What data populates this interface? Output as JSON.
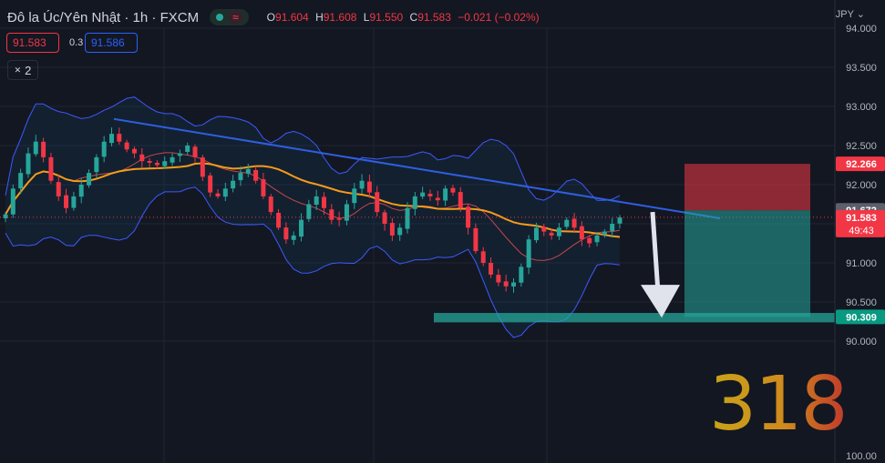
{
  "header": {
    "symbol": "Đô la Úc/Yên Nhật · 1h · FXCM",
    "ohlc": {
      "o_label": "O",
      "o": "91.604",
      "h_label": "H",
      "h": "91.608",
      "l_label": "L",
      "l": "91.550",
      "c_label": "C",
      "c": "91.583",
      "change": "−0.021 (−0.02%)"
    }
  },
  "quote": {
    "sell": "91.583",
    "spread": "0.3",
    "buy": "91.586"
  },
  "indicators_toggle": {
    "label": "2"
  },
  "currency": "JPY ⌄",
  "watermark": "318",
  "colors": {
    "up": "#26a69a",
    "down": "#f23645",
    "trendline": "#2f5fe0",
    "ma": "#f59c1a",
    "band": "#3d5afe"
  },
  "chart_data": {
    "type": "candlestick",
    "symbol": "AUDJPY",
    "timeframe": "1h",
    "y_axis": {
      "ticks": [
        "94.000",
        "93.500",
        "93.000",
        "92.500",
        "92.000",
        "91.500",
        "91.000",
        "90.500",
        "90.000",
        "100.00"
      ],
      "ylim": [
        89.6,
        94.1
      ],
      "side": "right"
    },
    "close_series": [
      91.62,
      91.95,
      92.15,
      92.4,
      92.55,
      92.35,
      92.05,
      91.85,
      91.7,
      91.85,
      92.0,
      92.15,
      92.35,
      92.55,
      92.65,
      92.55,
      92.45,
      92.4,
      92.3,
      92.28,
      92.25,
      92.3,
      92.35,
      92.4,
      92.5,
      92.35,
      92.1,
      91.9,
      91.85,
      91.95,
      92.05,
      92.15,
      92.2,
      92.05,
      91.85,
      91.65,
      91.45,
      91.3,
      91.35,
      91.55,
      91.75,
      91.85,
      91.7,
      91.55,
      91.55,
      91.75,
      91.95,
      92.05,
      91.9,
      91.65,
      91.5,
      91.35,
      91.45,
      91.7,
      91.85,
      91.9,
      91.85,
      91.8,
      91.95,
      91.9,
      91.7,
      91.45,
      91.15,
      91.0,
      90.85,
      90.75,
      90.7,
      90.75,
      90.95,
      91.3,
      91.45,
      91.4,
      91.35,
      91.45,
      91.55,
      91.45,
      91.3,
      91.25,
      91.35,
      91.4,
      91.5,
      91.58
    ],
    "price_labels": [
      {
        "value": "92.266",
        "role": "stop-loss"
      },
      {
        "value": "91.672",
        "role": "entry"
      },
      {
        "value": "91.583",
        "role": "last-price",
        "countdown": "49:43"
      },
      {
        "value": "90.309",
        "role": "take-profit"
      }
    ],
    "trendline": {
      "from_price": 92.84,
      "to_price": 91.57
    },
    "grid": true,
    "legend": "top-left"
  }
}
